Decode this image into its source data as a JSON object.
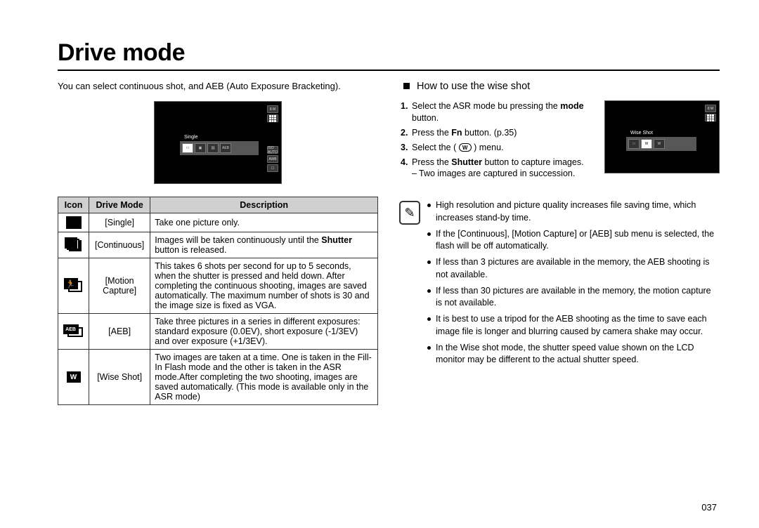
{
  "title": "Drive mode",
  "intro": "You can select continuous shot, and AEB (Auto Exposure Bracketing).",
  "lcd1": {
    "badge_top": "8 M",
    "menu_label": "Single",
    "opts": [
      "□",
      "▣",
      "⛓",
      "AEB"
    ],
    "side": [
      "ISO AUTO",
      "AWB",
      "☐"
    ]
  },
  "table": {
    "headers": [
      "Icon",
      "Drive Mode",
      "Description"
    ],
    "rows": [
      {
        "icon": "single",
        "mode": "[Single]",
        "desc_plain": "Take one picture only."
      },
      {
        "icon": "continuous",
        "mode": "[Continuous]",
        "desc_pre": "Images will be taken continuously until the ",
        "desc_bold": "Shutter",
        "desc_post": " button is released."
      },
      {
        "icon": "motion",
        "mode": "[Motion Capture]",
        "desc_plain": "This takes 6 shots per second for up to 5 seconds, when the shutter is pressed and held down. After completing the continuous shooting, images are saved automatically. The maximum number of shots is 30 and the image size is fixed as VGA."
      },
      {
        "icon": "aeb",
        "mode": "[AEB]",
        "desc_plain": "Take three pictures in a series in different exposures: standard exposure (0.0EV), short exposure (-1/3EV) and over exposure (+1/3EV)."
      },
      {
        "icon": "wise",
        "mode": "[Wise Shot]",
        "desc_plain": "Two images are taken at a time. One is taken in the Fill-In Flash mode and the other is taken in the ASR mode.After completing the two shooting, images are saved automatically. (This mode is available only in the ASR mode)"
      }
    ]
  },
  "right": {
    "section_title": "How to use the wise shot",
    "steps": {
      "s1_pre": "Select the ASR mode bu pressing the ",
      "s1_bold": "mode",
      "s1_post": " button.",
      "s2_pre": "Press the ",
      "s2_bold": "Fn",
      "s2_post": " button. (p.35)",
      "s3_pre": "Select the ( ",
      "s3_icon": "W",
      "s3_post": " ) menu.",
      "s4_pre": "Press the ",
      "s4_bold": "Shutter",
      "s4_post": " button to capture images.",
      "s4_sub": "Two images are captured in succession."
    },
    "lcd2": {
      "badge_top": "8 M",
      "menu_label": "Wise Shot",
      "opts": [
        "□",
        "W",
        "W"
      ]
    },
    "notes": [
      "High resolution and picture quality increases file saving time, which increases stand-by time.",
      "If the [Continuous], [Motion Capture] or [AEB] sub menu is selected, the flash will be off automatically.",
      "If less than 3 pictures are available in the memory, the AEB shooting is not available.",
      "If less than 30 pictures are available in the memory, the motion capture is not available.",
      "It is best to use a tripod for the AEB shooting as the time to save each image file is longer and blurring caused by camera shake may occur.",
      "In the Wise shot mode, the shutter speed value shown on the LCD monitor may be different to the actual shutter speed."
    ]
  },
  "page_number": "037",
  "note_icon_glyph": "✎"
}
